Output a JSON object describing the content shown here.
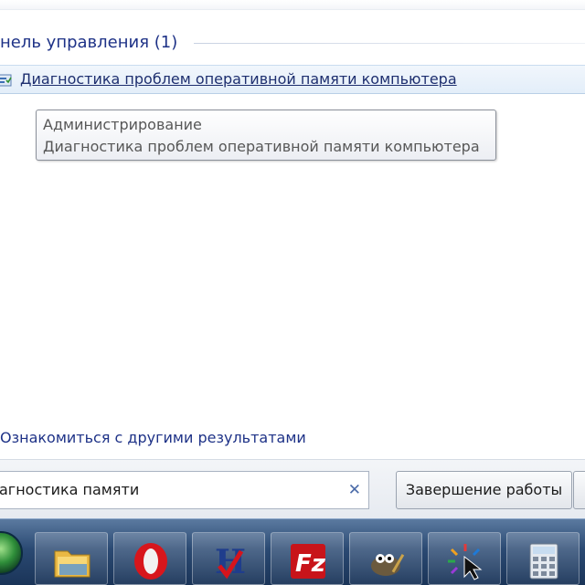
{
  "search_results": {
    "group_title": "нель управления (1)",
    "result_label": "Диагностика проблем оперативной памяти компьютера",
    "tooltip": {
      "line1": "Администрирование",
      "line2": "Диагностика проблем оперативной памяти компьютера"
    },
    "see_more": "Ознакомиться с другими результатами"
  },
  "search": {
    "value": "агностика памяти",
    "clear_icon": "✕"
  },
  "shutdown": {
    "label": "Завершение работы"
  },
  "taskbar": {
    "items": [
      {
        "icon": "folder-explorer-icon"
      },
      {
        "icon": "opera-icon"
      },
      {
        "icon": "hotspot-shield-icon"
      },
      {
        "icon": "filezilla-icon"
      },
      {
        "icon": "gimp-icon"
      },
      {
        "icon": "cursor-app-icon"
      },
      {
        "icon": "calculator-icon"
      }
    ]
  },
  "colors": {
    "link_blue": "#1e3287",
    "taskbar_top": "#5b7aa0",
    "taskbar_bottom": "#1a3458"
  }
}
